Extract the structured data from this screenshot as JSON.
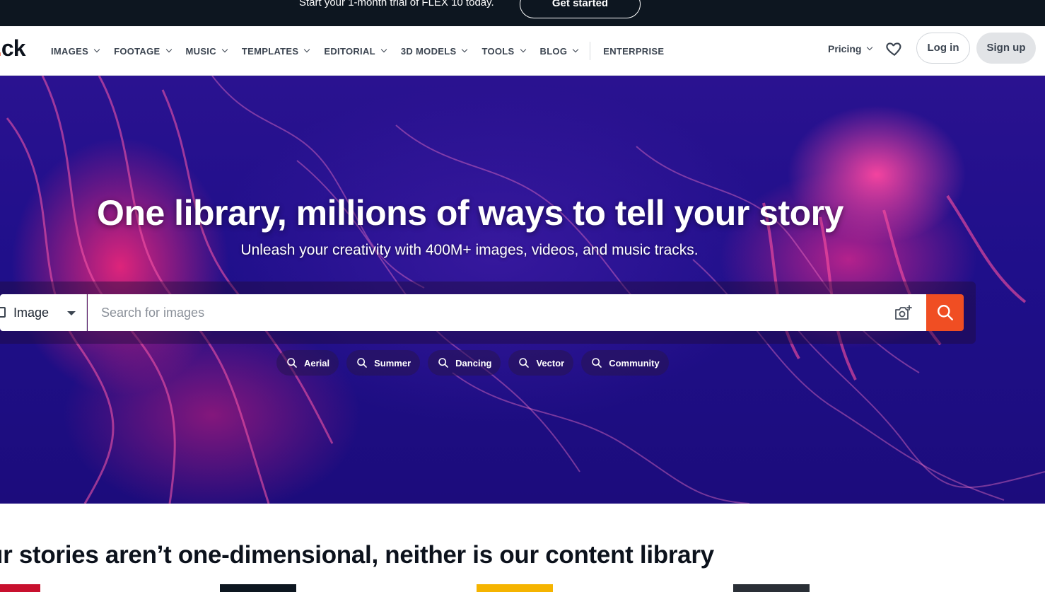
{
  "promo": {
    "text": "Start your 1-month trial of FLEX 10 today.",
    "cta": "Get started"
  },
  "nav": {
    "logo_text": "ck",
    "items": [
      {
        "label": "IMAGES"
      },
      {
        "label": "FOOTAGE"
      },
      {
        "label": "MUSIC"
      },
      {
        "label": "TEMPLATES"
      },
      {
        "label": "EDITORIAL"
      },
      {
        "label": "3D MODELS"
      },
      {
        "label": "TOOLS"
      },
      {
        "label": "BLOG"
      }
    ],
    "enterprise": "ENTERPRISE",
    "pricing": "Pricing",
    "login": "Log in",
    "signup": "Sign up"
  },
  "hero": {
    "title": "One library, millions of ways to tell your story",
    "subtitle": "Unleash your creativity with 400M+ images, videos, and music tracks.",
    "search": {
      "type_label": "Image",
      "placeholder": "Search for images"
    },
    "chips": [
      {
        "label": "Aerial"
      },
      {
        "label": "Summer"
      },
      {
        "label": "Dancing"
      },
      {
        "label": "Vector"
      },
      {
        "label": "Community"
      }
    ]
  },
  "section": {
    "title": "ur stories aren’t one-dimensional, neither is our content library"
  },
  "colors": {
    "accent": "#f04e23",
    "promo_bg": "#0d1620",
    "hero_bg": "#1f0f8a"
  }
}
